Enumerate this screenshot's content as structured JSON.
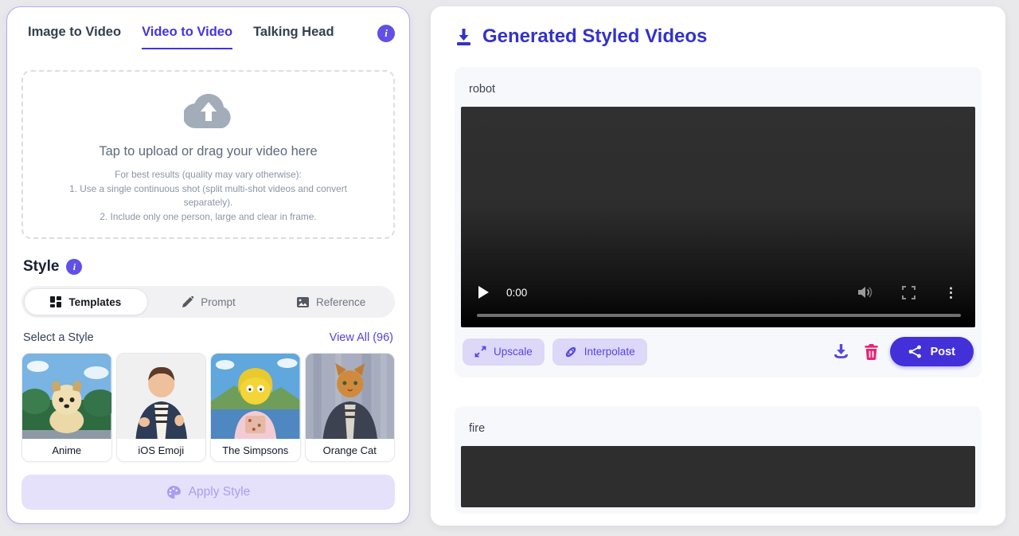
{
  "left_panel": {
    "tabs": [
      {
        "label": "Image to Video"
      },
      {
        "label": "Video to Video"
      },
      {
        "label": "Talking Head"
      }
    ],
    "info_glyph": "i",
    "upload": {
      "title": "Tap to upload or drag your video here",
      "hint_line1": "For best results (quality may vary otherwise):",
      "hint_line2": "1. Use a single continuous shot (split multi-shot videos and convert separately).",
      "hint_line3": "2. Include only one person, large and clear in frame."
    },
    "style": {
      "heading": "Style",
      "segments": [
        {
          "label": "Templates"
        },
        {
          "label": "Prompt"
        },
        {
          "label": "Reference"
        }
      ],
      "select_label": "Select a Style",
      "view_all": "View All (96)",
      "templates": [
        {
          "name": "Anime"
        },
        {
          "name": "iOS Emoji"
        },
        {
          "name": "The Simpsons"
        },
        {
          "name": "Orange Cat"
        }
      ],
      "apply_label": "Apply Style"
    }
  },
  "right_panel": {
    "title": "Generated Styled Videos",
    "videos": [
      {
        "name": "robot",
        "time": "0:00",
        "upscale_label": "Upscale",
        "interpolate_label": "Interpolate",
        "post_label": "Post",
        "menu_glyph": "⋮"
      },
      {
        "name": "fire"
      }
    ]
  },
  "colors": {
    "accent_purple": "#5646df",
    "active_tab": "#4433dd",
    "header_blue": "#3432c8",
    "trash_pink": "#ec2272",
    "post_blue": "#4330d8",
    "disabled_lavender": "#e5e1fb"
  }
}
